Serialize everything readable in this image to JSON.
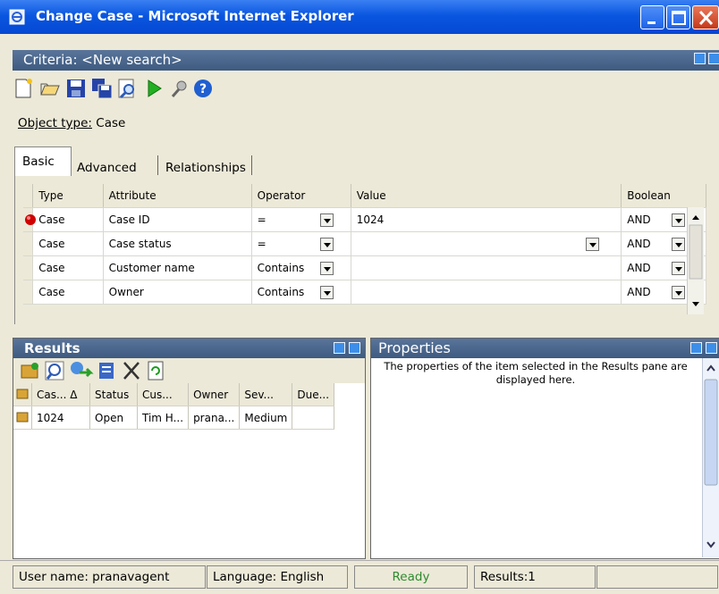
{
  "window": {
    "title": "Change Case - Microsoft Internet Explorer"
  },
  "criteria": {
    "header": "Criteria: <New search>",
    "object_type_label": "Object type:",
    "object_type_value": "Case",
    "tabs": [
      "Basic",
      "Advanced",
      "Relationships"
    ],
    "columns": [
      "Type",
      "Attribute",
      "Operator",
      "Value",
      "Boolean"
    ],
    "rows": [
      {
        "type": "Case",
        "attribute": "Case ID",
        "operator": "=",
        "value": "1024",
        "boolean": "AND"
      },
      {
        "type": "Case",
        "attribute": "Case status",
        "operator": "=",
        "value": "",
        "boolean": "AND"
      },
      {
        "type": "Case",
        "attribute": "Customer name",
        "operator": "Contains",
        "value": "",
        "boolean": "AND"
      },
      {
        "type": "Case",
        "attribute": "Owner",
        "operator": "Contains",
        "value": "",
        "boolean": "AND"
      }
    ]
  },
  "toolbar_icons": [
    "new-icon",
    "open-icon",
    "save-icon",
    "save-as-icon",
    "find-icon",
    "run-icon",
    "clear-icon",
    "help-icon"
  ],
  "results": {
    "header": "Results",
    "toolbar_icons": [
      "open-item-icon",
      "view-icon",
      "route-icon",
      "report-icon",
      "delete-icon",
      "refresh-icon"
    ],
    "columns": [
      "Cas... Δ",
      "Status",
      "Cus...",
      "Owner",
      "Sev...",
      "Due..."
    ],
    "rows": [
      {
        "case": "1024",
        "status": "Open",
        "customer": "Tim H...",
        "owner": "prana...",
        "severity": "Medium",
        "due": ""
      }
    ]
  },
  "properties": {
    "header": "Properties",
    "text": "The properties of the item selected in the Results pane are displayed here."
  },
  "status": {
    "user": "User name: pranavagent",
    "language": "Language: English",
    "state": "Ready",
    "results": "Results:1"
  },
  "colors": {
    "titlebar": "#0a56e0",
    "pane_header": "#4a6690",
    "ready": "#2e8b2e",
    "indicator": "#d00000"
  }
}
